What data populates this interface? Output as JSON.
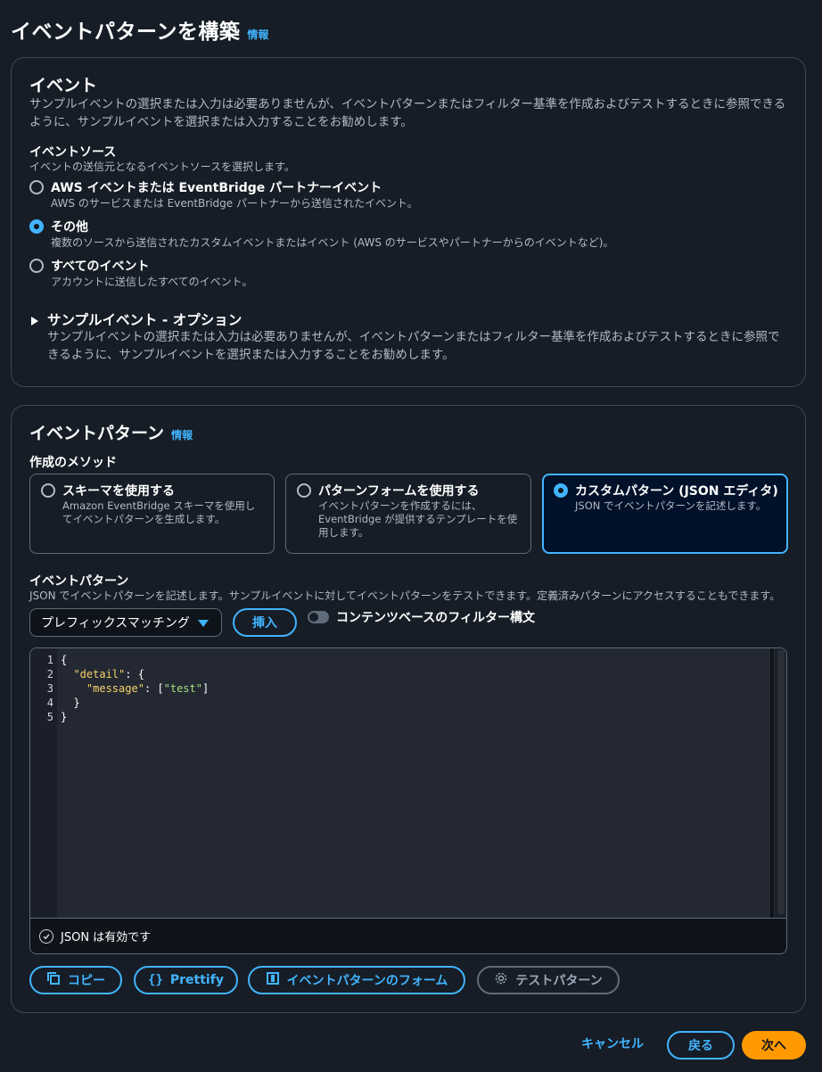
{
  "page": {
    "title": "イベントパターンを構築",
    "info": "情報"
  },
  "event_section": {
    "heading": "イベント",
    "description": "サンプルイベントの選択または入力は必要ありませんが、イベントパターンまたはフィルター基準を作成およびテストするときに参照できるように、サンプルイベントを選択または入力することをお勧めします。",
    "source_label": "イベントソース",
    "source_desc": "イベントの送信元となるイベントソースを選択します。",
    "options": [
      {
        "label": "AWS イベントまたは EventBridge パートナーイベント",
        "desc": "AWS のサービスまたは EventBridge パートナーから送信されたイベント。",
        "selected": false
      },
      {
        "label": "その他",
        "desc": "複数のソースから送信されたカスタムイベントまたはイベント (AWS のサービスやパートナーからのイベントなど)。",
        "selected": true
      },
      {
        "label": "すべてのイベント",
        "desc": "アカウントに送信したすべてのイベント。",
        "selected": false
      }
    ],
    "sample": {
      "label": "サンプルイベント - オプション",
      "desc": "サンプルイベントの選択または入力は必要ありませんが、イベントパターンまたはフィルター基準を作成およびテストするときに参照できるように、サンプルイベントを選択または入力することをお勧めします。"
    }
  },
  "pattern_section": {
    "heading": "イベントパターン",
    "info": "情報",
    "method_label": "作成のメソッド",
    "methods": [
      {
        "label": "スキーマを使用する",
        "desc": "Amazon EventBridge スキーマを使用してイベントパターンを生成します。",
        "selected": false
      },
      {
        "label": "パターンフォームを使用する",
        "desc": "イベントパターンを作成するには、EventBridge が提供するテンプレートを使用します。",
        "selected": false
      },
      {
        "label": "カスタムパターン (JSON エディタ)",
        "desc": "JSON でイベントパターンを記述します。",
        "selected": true
      }
    ],
    "pattern_label": "イベントパターン",
    "pattern_desc": "JSON でイベントパターンを記述します。サンプルイベントに対してイベントパターンをテストできます。定義済みパターンにアクセスすることもできます。",
    "select_value": "プレフィックスマッチング",
    "insert_label": "挿入",
    "toggle_label": "コンテンツベースのフィルター構文",
    "toggle_on": false,
    "code_lines": [
      {
        "no": "1",
        "text": "{"
      },
      {
        "no": "2",
        "indent": "  ",
        "key": "\"detail\"",
        "rest": ": {"
      },
      {
        "no": "3",
        "indent": "    ",
        "key": "\"message\"",
        "rest": ": [",
        "str": "\"test\"",
        "tail": "]"
      },
      {
        "no": "4",
        "text": "  }"
      },
      {
        "no": "5",
        "text": "}"
      }
    ],
    "status": "JSON は有効です",
    "buttons": {
      "copy": "コピー",
      "prettify": "Prettify",
      "form": "イベントパターンのフォーム",
      "test": "テストパターン"
    }
  },
  "footer": {
    "cancel": "キャンセル",
    "back": "戻る",
    "next": "次へ"
  },
  "colors": {
    "accent": "#42b4ff",
    "primary": "#ff9900",
    "background": "#161d26"
  }
}
